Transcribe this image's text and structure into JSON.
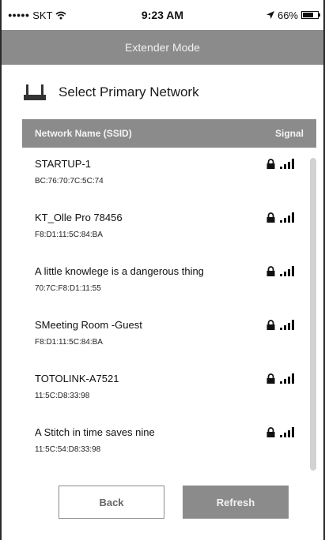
{
  "status_bar": {
    "signal_dots": "●●●●●",
    "carrier": "SKT",
    "time": "9:23 AM",
    "battery_text": "66%",
    "battery_level": 0.66
  },
  "navbar": {
    "title": "Extender Mode"
  },
  "section": {
    "title": "Select Primary Network",
    "icon": "router-icon"
  },
  "table": {
    "col_name": "Network Name (SSID)",
    "col_signal": "Signal",
    "rows": [
      {
        "ssid": "STARTUP-1",
        "mac": "BC:76:70:7C:5C:74",
        "locked": true,
        "signal": 4
      },
      {
        "ssid": "KT_Olle Pro 78456",
        "mac": "F8:D1:11:5C:84:BA",
        "locked": true,
        "signal": 4
      },
      {
        "ssid": "A little knowlege is a dangerous thing",
        "mac": "70:7C:F8:D1:11:55",
        "locked": true,
        "signal": 4
      },
      {
        "ssid": "SMeeting Room -Guest",
        "mac": "F8:D1:11:5C:84:BA",
        "locked": true,
        "signal": 4
      },
      {
        "ssid": "TOTOLINK-A7521",
        "mac": "11:5C:D8:33:98",
        "locked": true,
        "signal": 4
      },
      {
        "ssid": "A Stitch in time saves nine",
        "mac": "11:5C:54:D8:33:98",
        "locked": true,
        "signal": 4
      }
    ]
  },
  "buttons": {
    "back": "Back",
    "refresh": "Refresh"
  },
  "colors": {
    "bar_gray": "#8b8b8b",
    "scroll_gray": "#d2d2d2"
  }
}
